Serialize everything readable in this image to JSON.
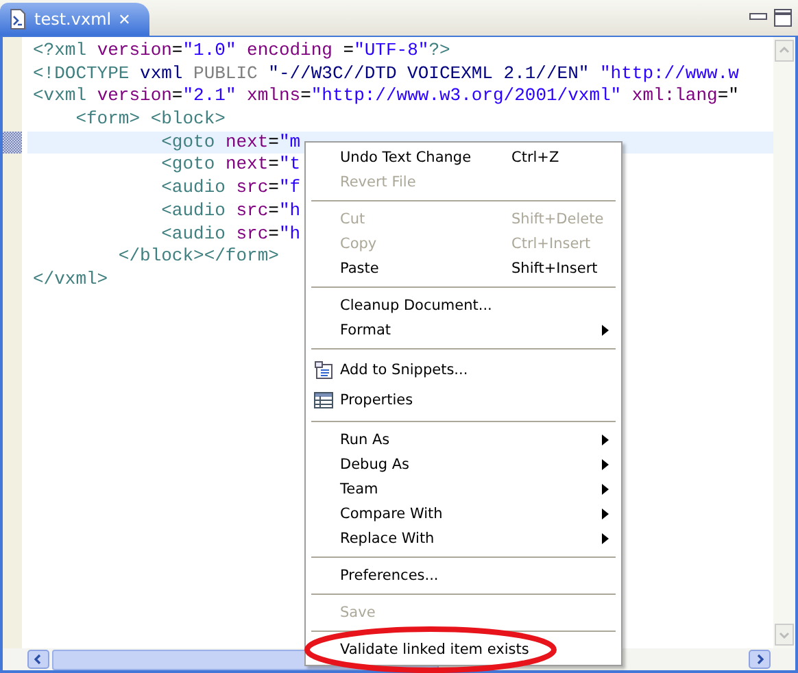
{
  "tab": {
    "title": "test.vxml",
    "close": "✕"
  },
  "code_lines": [
    {
      "current": false,
      "tokens": [
        {
          "kind": "tag",
          "text": "<?xml "
        },
        {
          "kind": "attr",
          "text": "version"
        },
        {
          "kind": "plain",
          "text": "="
        },
        {
          "kind": "value",
          "text": "\"1.0\" "
        },
        {
          "kind": "attr",
          "text": "encoding"
        },
        {
          "kind": "plain",
          "text": " ="
        },
        {
          "kind": "value",
          "text": "\"UTF-8\""
        },
        {
          "kind": "tag",
          "text": "?>"
        }
      ]
    },
    {
      "current": false,
      "tokens": [
        {
          "kind": "tag",
          "text": "<!DOCTYPE "
        },
        {
          "kind": "name",
          "text": "vxml "
        },
        {
          "kind": "keyword",
          "text": "PUBLIC "
        },
        {
          "kind": "name",
          "text": "\"-//W3C//DTD VOICEXML 2.1//EN\" "
        },
        {
          "kind": "value",
          "text": "\"http://www.w"
        }
      ]
    },
    {
      "current": false,
      "tokens": [
        {
          "kind": "tag",
          "text": "<vxml "
        },
        {
          "kind": "attr",
          "text": "version"
        },
        {
          "kind": "plain",
          "text": "="
        },
        {
          "kind": "value",
          "text": "\"2.1\" "
        },
        {
          "kind": "attr",
          "text": "xmlns"
        },
        {
          "kind": "plain",
          "text": "="
        },
        {
          "kind": "value",
          "text": "\"http://www.w3.org/2001/vxml\" "
        },
        {
          "kind": "attr",
          "text": "xml:lang"
        },
        {
          "kind": "plain",
          "text": "=\""
        }
      ]
    },
    {
      "current": false,
      "tokens": [
        {
          "kind": "tag",
          "text": "    <form> <block>"
        }
      ]
    },
    {
      "current": true,
      "tokens": [
        {
          "kind": "tag",
          "text": "            <goto "
        },
        {
          "kind": "attr",
          "text": "next"
        },
        {
          "kind": "plain",
          "text": "="
        },
        {
          "kind": "value",
          "text": "\"m"
        }
      ]
    },
    {
      "current": false,
      "tokens": [
        {
          "kind": "tag",
          "text": "            <goto "
        },
        {
          "kind": "attr",
          "text": "next"
        },
        {
          "kind": "plain",
          "text": "="
        },
        {
          "kind": "value",
          "text": "\"t"
        }
      ]
    },
    {
      "current": false,
      "tokens": [
        {
          "kind": "tag",
          "text": "            <audio "
        },
        {
          "kind": "attr",
          "text": "src"
        },
        {
          "kind": "plain",
          "text": "="
        },
        {
          "kind": "value",
          "text": "\"f"
        }
      ]
    },
    {
      "current": false,
      "tokens": [
        {
          "kind": "tag",
          "text": "            <audio "
        },
        {
          "kind": "attr",
          "text": "src"
        },
        {
          "kind": "plain",
          "text": "="
        },
        {
          "kind": "value",
          "text": "\"h"
        }
      ]
    },
    {
      "current": false,
      "tokens": [
        {
          "kind": "tag",
          "text": "            <audio "
        },
        {
          "kind": "attr",
          "text": "src"
        },
        {
          "kind": "plain",
          "text": "="
        },
        {
          "kind": "value",
          "text": "\"h"
        }
      ]
    },
    {
      "current": false,
      "tokens": [
        {
          "kind": "tag",
          "text": "        </block></form>"
        }
      ]
    },
    {
      "current": false,
      "tokens": [
        {
          "kind": "tag",
          "text": "</vxml>"
        }
      ]
    }
  ],
  "context_menu": {
    "items": [
      {
        "kind": "item",
        "label": "Undo Text Change",
        "shortcut": "Ctrl+Z",
        "disabled": false,
        "submenu": false
      },
      {
        "kind": "item",
        "label": "Revert File",
        "disabled": true,
        "submenu": false
      },
      {
        "kind": "separator"
      },
      {
        "kind": "item",
        "label": "Cut",
        "shortcut": "Shift+Delete",
        "disabled": true,
        "submenu": false
      },
      {
        "kind": "item",
        "label": "Copy",
        "shortcut": "Ctrl+Insert",
        "disabled": true,
        "submenu": false
      },
      {
        "kind": "item",
        "label": "Paste",
        "shortcut": "Shift+Insert",
        "disabled": false,
        "submenu": false
      },
      {
        "kind": "separator"
      },
      {
        "kind": "item",
        "label": "Cleanup Document...",
        "disabled": false,
        "submenu": false
      },
      {
        "kind": "item",
        "label": "Format",
        "disabled": false,
        "submenu": true
      },
      {
        "kind": "separator"
      },
      {
        "kind": "snippet-item",
        "label": "Add to Snippets...",
        "disabled": false,
        "submenu": false
      },
      {
        "kind": "table-item",
        "label": "Properties",
        "disabled": false,
        "submenu": false
      },
      {
        "kind": "separator"
      },
      {
        "kind": "item",
        "label": "Run As",
        "disabled": false,
        "submenu": true
      },
      {
        "kind": "item",
        "label": "Debug As",
        "disabled": false,
        "submenu": true
      },
      {
        "kind": "item",
        "label": "Team",
        "disabled": false,
        "submenu": true
      },
      {
        "kind": "item",
        "label": "Compare With",
        "disabled": false,
        "submenu": true
      },
      {
        "kind": "item",
        "label": "Replace With",
        "disabled": false,
        "submenu": true
      },
      {
        "kind": "separator"
      },
      {
        "kind": "item",
        "label": "Preferences...",
        "disabled": false,
        "submenu": false
      },
      {
        "kind": "separator"
      },
      {
        "kind": "item",
        "label": "Save",
        "disabled": true,
        "submenu": false
      },
      {
        "kind": "separator"
      },
      {
        "kind": "item",
        "label": "Validate linked item exists",
        "disabled": false,
        "submenu": false,
        "circled": true
      }
    ]
  }
}
